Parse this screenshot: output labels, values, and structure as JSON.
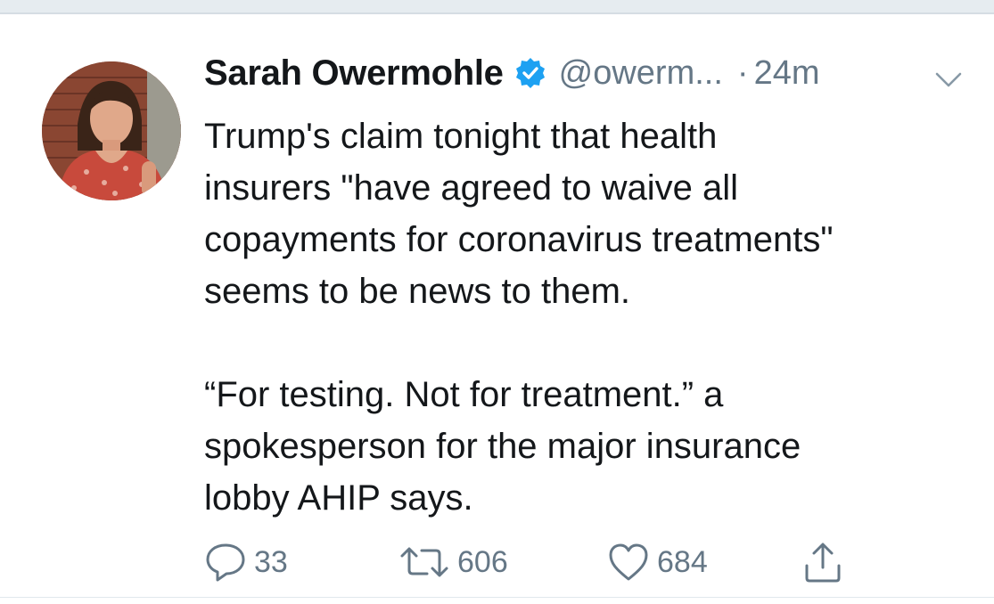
{
  "tweet": {
    "author_name": "Sarah Owermohle",
    "handle": "@owerm...",
    "separator": "·",
    "time": "24m",
    "paragraph1": [
      "Trump's claim tonight that health",
      "insurers \"have agreed to waive all",
      "copayments for coronavirus treatments\"",
      "seems to be news to them."
    ],
    "paragraph2": [
      "“For testing. Not for treatment.” a",
      "spokesperson for the major insurance",
      "lobby AHIP says."
    ]
  },
  "actions": {
    "replies": "33",
    "retweets": "606",
    "likes": "684"
  },
  "icons": {
    "verified": "verified-badge-icon",
    "menu": "chevron-down-icon",
    "reply": "reply-icon",
    "retweet": "retweet-icon",
    "like": "heart-icon",
    "share": "share-icon"
  },
  "colors": {
    "text": "#14171a",
    "secondary": "#657786",
    "verified_blue": "#1da1f2",
    "background": "#ffffff"
  }
}
